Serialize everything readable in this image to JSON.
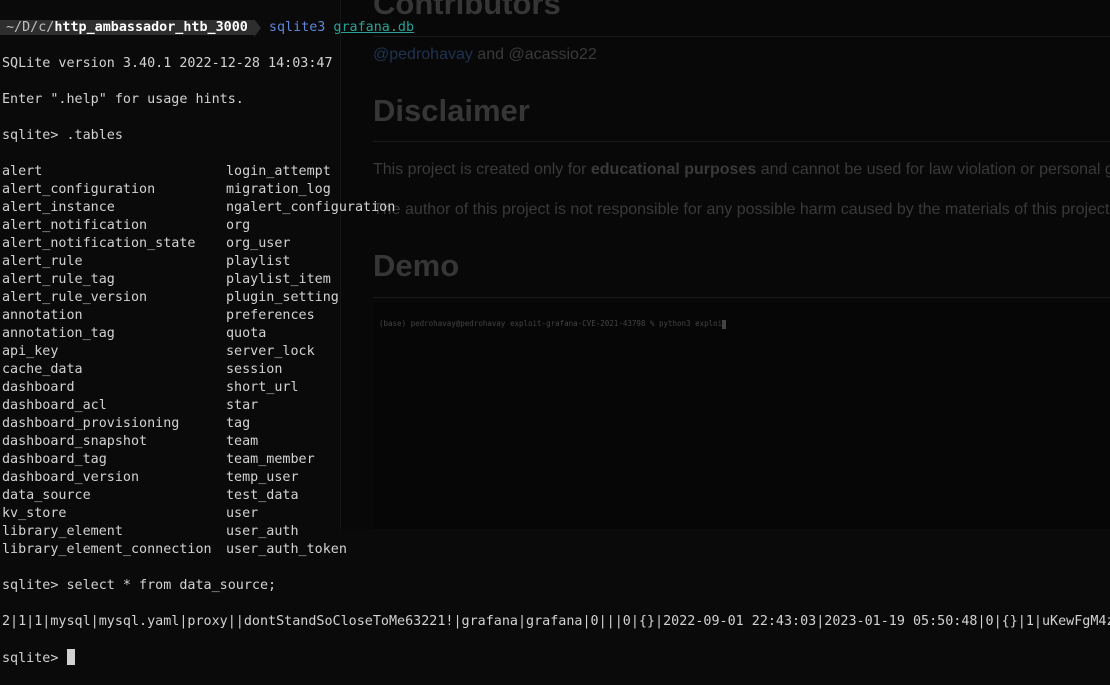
{
  "browser_page": {
    "heading_contributors": "Contributors",
    "contributors": {
      "user1": "@pedrohavay",
      "and": " and ",
      "user2": "@acassio22"
    },
    "heading_disclaimer": "Disclaimer",
    "disclaimer_p1": {
      "pre": "This project is created only for ",
      "bold": "educational purposes",
      "post": " and cannot be used for law violation or personal g"
    },
    "disclaimer_p2": "The author of this project is not responsible for any possible harm caused by the materials of this project",
    "heading_demo": "Demo",
    "demo_terminal_text": "(base) pedrohavay@pedrohavay exploit-grafana-CVE-2021-43798 % python3 exploi"
  },
  "terminal": {
    "prompt_path_prefix": "~/D/c/",
    "prompt_path_dir": "http_ambassador_htb_3000",
    "command": "sqlite3",
    "command_arg": "grafana.db",
    "version_line": "SQLite version 3.40.1 2022-12-28 14:03:47",
    "help_line": "Enter \".help\" for usage hints.",
    "cmd_tables": "sqlite> .tables",
    "tables": [
      [
        "alert",
        "login_attempt"
      ],
      [
        "alert_configuration",
        "migration_log"
      ],
      [
        "alert_instance",
        "ngalert_configuration"
      ],
      [
        "alert_notification",
        "org"
      ],
      [
        "alert_notification_state",
        "org_user"
      ],
      [
        "alert_rule",
        "playlist"
      ],
      [
        "alert_rule_tag",
        "playlist_item"
      ],
      [
        "alert_rule_version",
        "plugin_setting"
      ],
      [
        "annotation",
        "preferences"
      ],
      [
        "annotation_tag",
        "quota"
      ],
      [
        "api_key",
        "server_lock"
      ],
      [
        "cache_data",
        "session"
      ],
      [
        "dashboard",
        "short_url"
      ],
      [
        "dashboard_acl",
        "star"
      ],
      [
        "dashboard_provisioning",
        "tag"
      ],
      [
        "dashboard_snapshot",
        "team"
      ],
      [
        "dashboard_tag",
        "team_member"
      ],
      [
        "dashboard_version",
        "temp_user"
      ],
      [
        "data_source",
        "test_data"
      ],
      [
        "kv_store",
        "user"
      ],
      [
        "library_element",
        "user_auth"
      ],
      [
        "library_element_connection",
        "user_auth_token"
      ]
    ],
    "cmd_select": "sqlite> select * from data_source;",
    "result_row": "2|1|1|mysql|mysql.yaml|proxy||dontStandSoCloseToMe63221!|grafana|grafana|0|||0|{}|2022-09-01 22:43:03|2023-01-19 05:50:48|0|{}|1|uKewFgM4z",
    "final_prompt": "sqlite> "
  }
}
